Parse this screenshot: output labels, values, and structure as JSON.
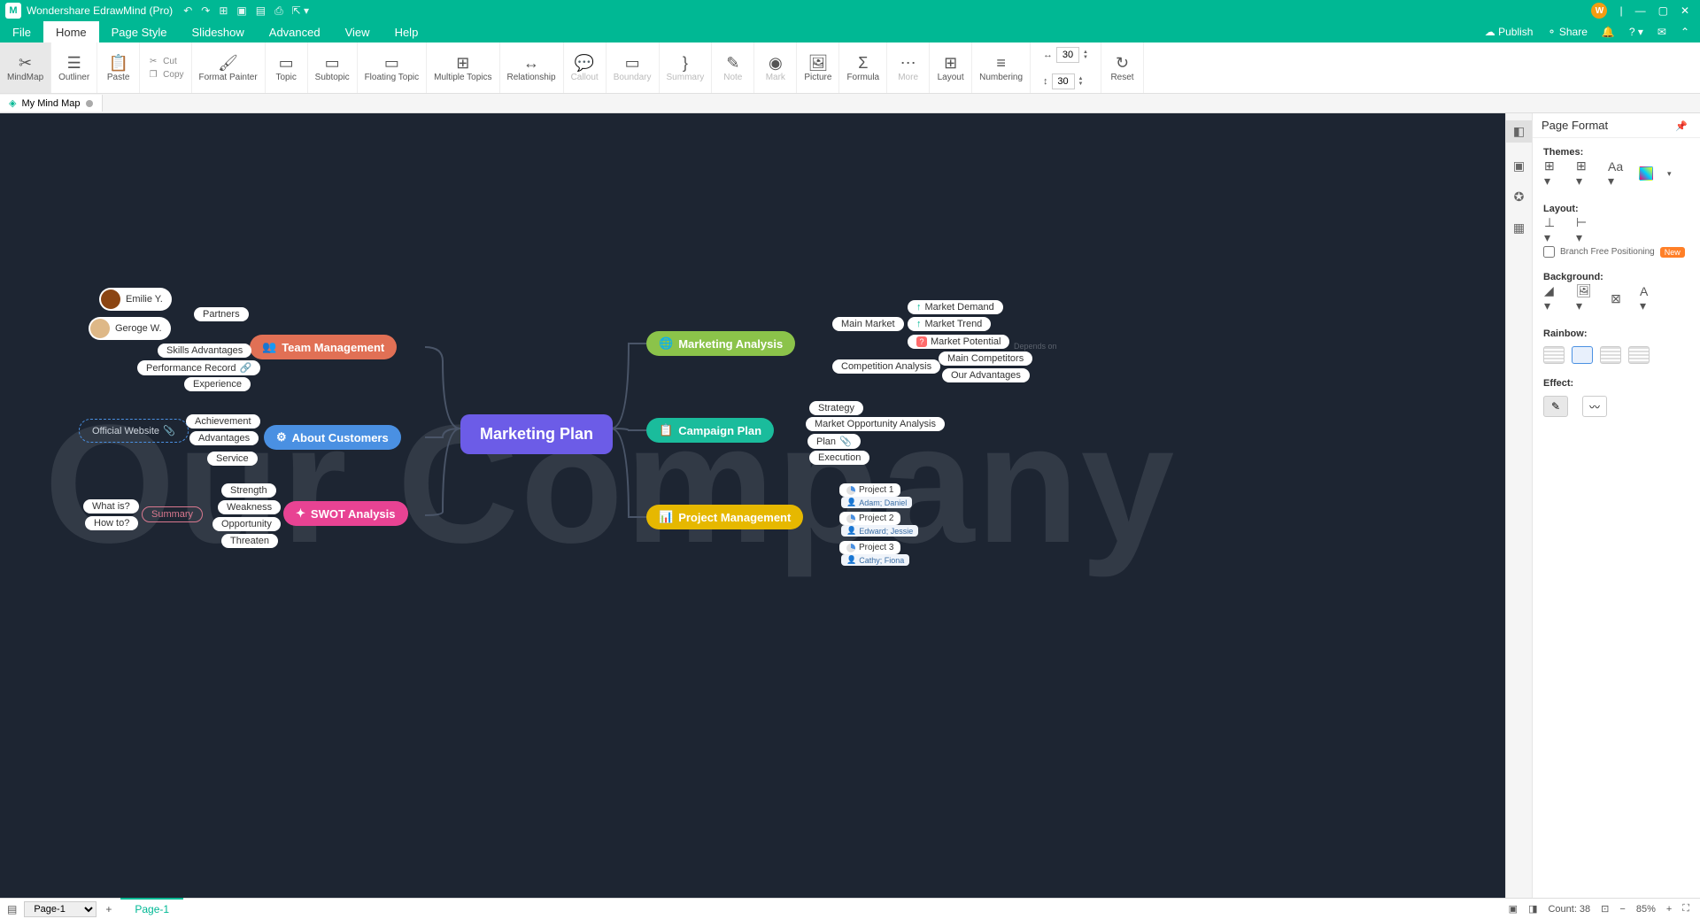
{
  "app_title": "Wondershare EdrawMind (Pro)",
  "avatar_letter": "W",
  "menu": {
    "tabs": [
      "File",
      "Home",
      "Page Style",
      "Slideshow",
      "Advanced",
      "View",
      "Help"
    ],
    "active": "Home",
    "publish": "Publish",
    "share": "Share"
  },
  "ribbon": {
    "mindmap": "MindMap",
    "outliner": "Outliner",
    "paste": "Paste",
    "cut": "Cut",
    "copy": "Copy",
    "format_painter": "Format\nPainter",
    "topic": "Topic",
    "subtopic": "Subtopic",
    "floating_topic": "Floating\nTopic",
    "multiple_topics": "Multiple\nTopics",
    "relationship": "Relationship",
    "callout": "Callout",
    "boundary": "Boundary",
    "summary": "Summary",
    "note": "Note",
    "mark": "Mark",
    "picture": "Picture",
    "formula": "Formula",
    "more": "More",
    "layout": "Layout",
    "numbering": "Numbering",
    "width_val": "30",
    "height_val": "30",
    "reset": "Reset"
  },
  "tab": {
    "name": "My Mind Map"
  },
  "watermark": "Our Company",
  "mindmap": {
    "central": "Marketing Plan",
    "left_branches": {
      "team": {
        "label": "Team Management",
        "people": [
          {
            "name": "Emilie Y."
          },
          {
            "name": "Geroge W."
          }
        ],
        "partners": "Partners",
        "skills": "Skills Advantages",
        "performance": "Performance Record",
        "experience": "Experience"
      },
      "customers": {
        "label": "About Customers",
        "official": "Official Website",
        "achievement": "Achievement",
        "advantages": "Advantages",
        "service": "Service"
      },
      "swot": {
        "label": "SWOT Analysis",
        "summary": "Summary",
        "what": "What is?",
        "how": "How to?",
        "strength": "Strength",
        "weakness": "Weakness",
        "opportunity": "Opportunity",
        "threaten": "Threaten"
      }
    },
    "right_branches": {
      "marketing": {
        "label": "Marketing Analysis",
        "main_market": "Main Market",
        "market_demand": "Market Demand",
        "market_trend": "Market Trend",
        "market_potential": "Market Potential",
        "depends_on": "Depends on",
        "competition": "Competition Analysis",
        "competitors": "Main Competitors",
        "our_adv": "Our Advantages"
      },
      "campaign": {
        "label": "Campaign Plan",
        "strategy": "Strategy",
        "moa": "Market Opportunity Analysis",
        "plan": "Plan",
        "execution": "Execution"
      },
      "project": {
        "label": "Project Management",
        "projects": [
          {
            "name": "Project 1",
            "assignee": "Adam; Daniel"
          },
          {
            "name": "Project 2",
            "assignee": "Edward; Jessie"
          },
          {
            "name": "Project 3",
            "assignee": "Cathy; Fiona"
          }
        ]
      }
    }
  },
  "panel": {
    "title": "Page Format",
    "themes": "Themes:",
    "layout": "Layout:",
    "branch_free": "Branch Free Positioning",
    "new_badge": "New",
    "background": "Background:",
    "rainbow": "Rainbow:",
    "effect": "Effect:"
  },
  "status": {
    "page_select": "Page-1",
    "page_tab": "Page-1",
    "count": "Count: 38",
    "zoom": "85%"
  }
}
